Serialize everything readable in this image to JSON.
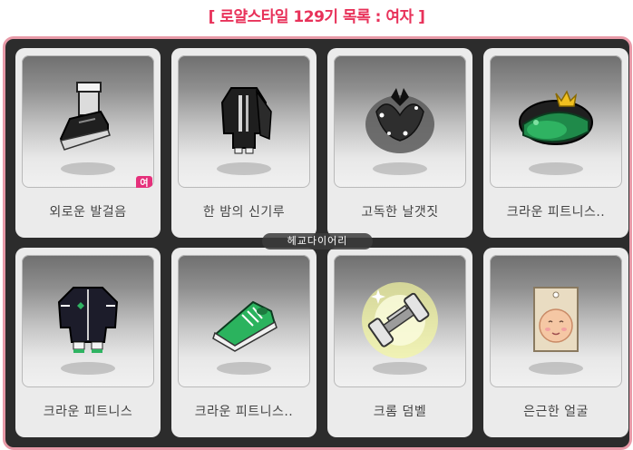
{
  "title": "[ 로얄스타일 129기 목록 : 여자 ]",
  "watermark": "헤교다이어리",
  "badge_label": "여",
  "items": [
    {
      "name": "외로운 발걸음",
      "icon": "shoe-icon"
    },
    {
      "name": "한 밤의 신기루",
      "icon": "outfit-icon"
    },
    {
      "name": "고독한 날갯짓",
      "icon": "wings-icon"
    },
    {
      "name": "크라운 피트니스..",
      "icon": "cap-icon"
    },
    {
      "name": "크라운 피트니스",
      "icon": "jacket-icon"
    },
    {
      "name": "크라운 피트니스..",
      "icon": "sneaker-icon"
    },
    {
      "name": "크롬 덤벨",
      "icon": "dumbbell-icon"
    },
    {
      "name": "은근한 얼굴",
      "icon": "face-icon"
    }
  ]
}
